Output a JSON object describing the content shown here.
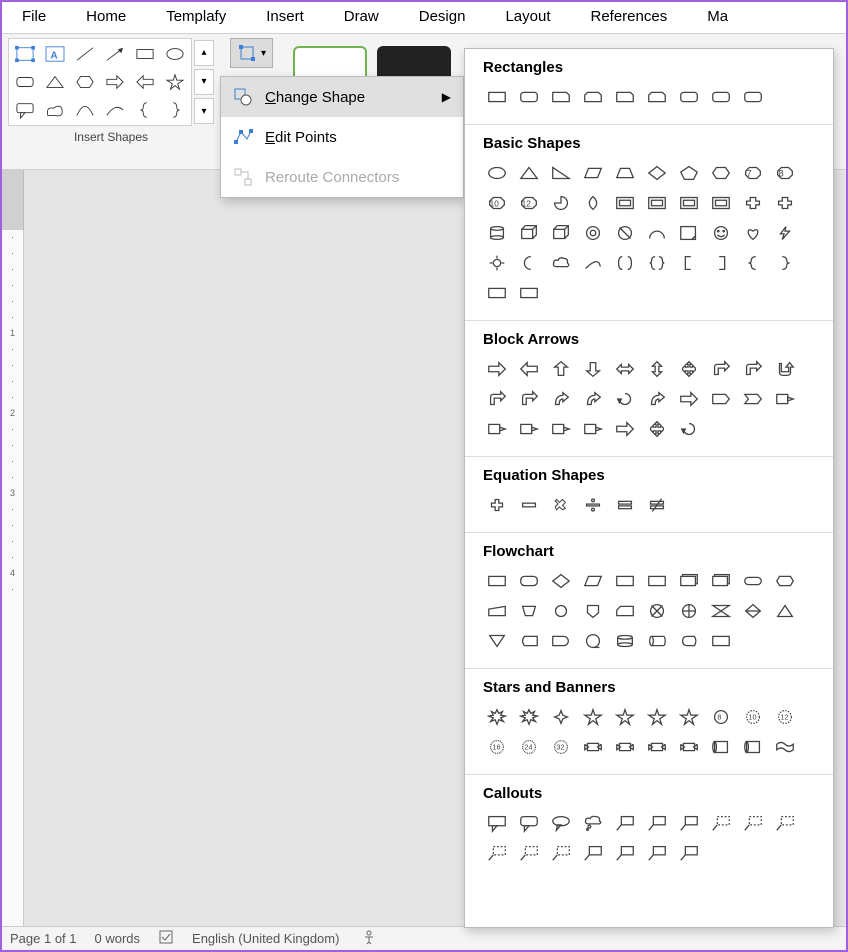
{
  "ribbon": {
    "tabs": [
      "File",
      "Home",
      "Templafy",
      "Insert",
      "Draw",
      "Design",
      "Layout",
      "References",
      "Ma"
    ]
  },
  "insert_shapes_label": "Insert Shapes",
  "context_menu": {
    "change_shape": "Change Shape",
    "edit_points": "Edit Points",
    "reroute_connectors": "Reroute Connectors"
  },
  "shape_panel": {
    "categories": [
      {
        "title": "Rectangles",
        "count": 9
      },
      {
        "title": "Basic Shapes",
        "count": 42
      },
      {
        "title": "Block Arrows",
        "count": 27
      },
      {
        "title": "Equation Shapes",
        "count": 6
      },
      {
        "title": "Flowchart",
        "count": 28
      },
      {
        "title": "Stars and Banners",
        "count": 20
      },
      {
        "title": "Callouts",
        "count": 17
      }
    ]
  },
  "status_bar": {
    "page": "Page 1 of 1",
    "words": "0 words",
    "language": "English (United Kingdom)"
  }
}
